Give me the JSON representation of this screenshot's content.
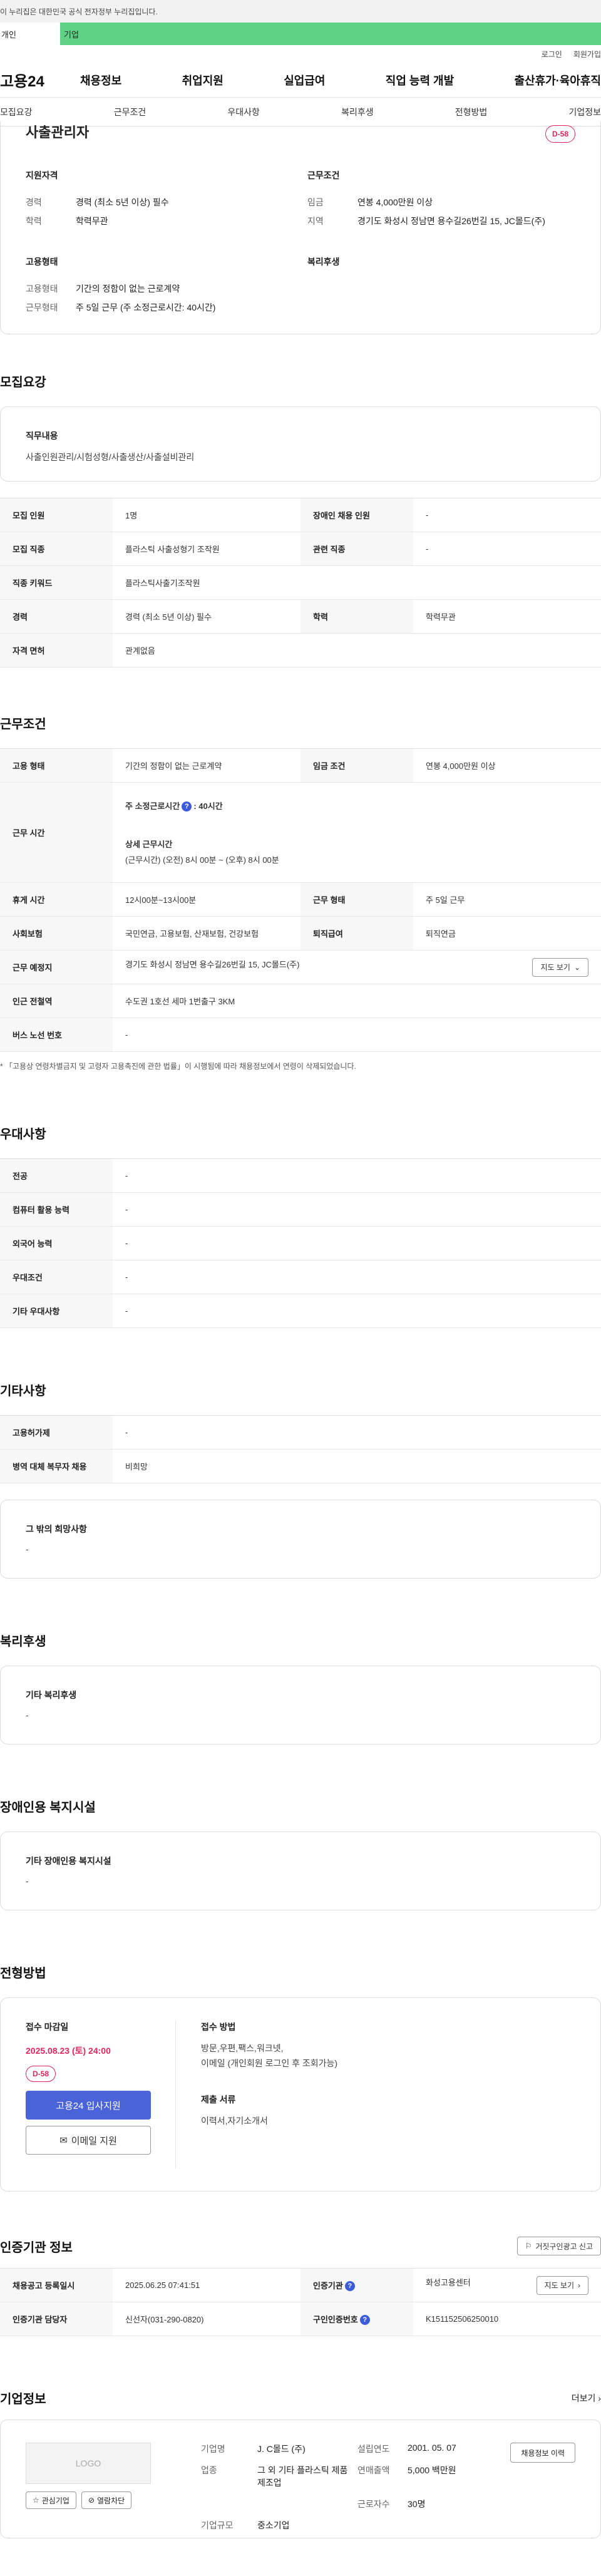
{
  "banner": "이 누리집은 대한민국 공식 전자정부 누리집입니다.",
  "user_tabs": [
    "개인",
    "기업"
  ],
  "util": [
    "로그인",
    "회원가입"
  ],
  "gnb": {
    "logo": "고용24",
    "menu": [
      "채용정보",
      "취업지원",
      "실업급여",
      "직업 능력 개발",
      "출산휴가·육아휴직"
    ]
  },
  "subnav": [
    "모집요강",
    "근무조건",
    "우대사항",
    "복리후생",
    "전형방법",
    "기업정보"
  ],
  "summary": {
    "title": "사출관리자",
    "dday": "D-58",
    "qual_head": "지원자격",
    "qual": [
      {
        "k": "경력",
        "v": "경력 (최소 5년 이상) 필수"
      },
      {
        "k": "학력",
        "v": "학력무관"
      }
    ],
    "cond_head": "근무조건",
    "cond": [
      {
        "k": "임금",
        "v": "연봉 4,000만원 이상"
      },
      {
        "k": "지역",
        "v": "경기도 화성시 정남면 용수길26번길 15, JC몰드(주)"
      }
    ],
    "emp_head": "고용형태",
    "emp": [
      {
        "k": "고용형태",
        "v": "기간의 정함이 없는 근로계약"
      },
      {
        "k": "근무형태",
        "v": "주 5일 근무 (주 소정근로시간: 40시간)"
      }
    ],
    "welfare_head": "복리후생"
  },
  "recruit": {
    "title": "모집요강",
    "duty_head": "직무내용",
    "duty": "사출인원관리/시험성형/사출생산/사출설비관리",
    "rows": [
      [
        {
          "th": "모집 인원"
        },
        {
          "v": "1명"
        },
        {
          "th": "장애인 채용 인원"
        },
        {
          "v": "-"
        }
      ],
      [
        {
          "th": "모집 직종"
        },
        {
          "v": "플라스틱 사출성형기 조작원"
        },
        {
          "th": "관련 직종"
        },
        {
          "v": "-"
        }
      ],
      [
        {
          "th": "직종 키워드"
        },
        {
          "v": "플라스틱사출기조작원"
        }
      ],
      [
        {
          "th": "경력"
        },
        {
          "v": "경력 (최소 5년 이상) 필수"
        },
        {
          "th": "학력"
        },
        {
          "v": "학력무관"
        }
      ],
      [
        {
          "th": "자격 면허"
        },
        {
          "v": "관계없음"
        }
      ]
    ]
  },
  "work": {
    "title": "근무조건",
    "emp_type_th": "고용 형태",
    "emp_type": "기간의 정함이 없는 근로계약",
    "wage_th": "임금 조건",
    "wage": "연봉 4,000만원 이상",
    "hours_th": "근무 시간",
    "hours_main": "주 소정근로시간",
    "hours_main_val": ": 40시간",
    "hours_detail_head": "상세 근무시간",
    "hours_detail": "(근무시간) (오전) 8시 00분 ~ (오후) 8시 00분",
    "break_th": "휴게 시간",
    "break": "12시00분~13시00분",
    "form_th": "근무 형태",
    "form": "주 5일 근무",
    "insure_th": "사회보험",
    "insure": "국민연금, 고용보험, 산재보험, 건강보험",
    "retire_th": "퇴직급여",
    "retire": "퇴직연금",
    "place_th": "근무 예정지",
    "place": "경기도 화성시 정남면 용수길26번길 15, JC몰드(주)",
    "map_btn": "지도 보기",
    "subway_th": "인근 전철역",
    "subway": "수도권 1호선 세마 1번출구 3KM",
    "bus_th": "버스 노선 번호",
    "bus": "-",
    "note": "* 「고용상 연령차별금지 및 고령자 고용촉진에 관한 법률」이 시행됨에 따라 채용정보에서 연령이 삭제되었습니다."
  },
  "prefer": {
    "title": "우대사항",
    "rows": [
      {
        "th": "전공",
        "v": "-"
      },
      {
        "th": "컴퓨터 활용 능력",
        "v": "-"
      },
      {
        "th": "외국어 능력",
        "v": "-"
      },
      {
        "th": "우대조건",
        "v": "-"
      },
      {
        "th": "기타 우대사항",
        "v": "-"
      }
    ]
  },
  "etc": {
    "title": "기타사항",
    "rows": [
      {
        "th": "고용허가제",
        "v": "-"
      },
      {
        "th": "병역 대체 복무자 채용",
        "v": "비희망"
      }
    ],
    "box_head": "그 밖의 희망사항",
    "box_val": "-"
  },
  "welfare": {
    "title": "복리후생",
    "box_head": "기타 복리후생",
    "box_val": "-"
  },
  "disabled": {
    "title": "장애인용 복지시설",
    "box_head": "기타 장애인용 복지시설",
    "box_val": "-"
  },
  "selection": {
    "title": "전형방법",
    "deadline_label": "접수 마감일",
    "deadline": "2025.08.23 (토) 24:00",
    "dday": "D-58",
    "apply_btn": "고용24 입사지원",
    "email_btn": "이메일 지원",
    "method_head": "접수 방법",
    "method": "방문,우편,팩스,워크넷,",
    "method2": "이메일 (개인회원 로그인 후 조회가능)",
    "docs_head": "제출 서류",
    "docs": "이력서,자기소개서"
  },
  "cert": {
    "title": "인증기관 정보",
    "report_btn": "거짓구인광고 신고",
    "reg_th": "채용공고 등록일시",
    "reg": "2025.06.25 07:41:51",
    "org_th": "인증기관",
    "org": "화성고용센터",
    "map_btn": "지도 보기",
    "mgr_th": "인증기관 담당자",
    "mgr": "신선자(031-290-0820)",
    "no_th": "구인인증번호",
    "no": "K151152506250010"
  },
  "company": {
    "title": "기업정보",
    "more": "더보기",
    "logo": "LOGO",
    "fav_btn": "관심기업",
    "block_btn": "열람차단",
    "name_k": "기업명",
    "name": "J. C몰드 (주)",
    "found_k": "설립연도",
    "found": "2001. 05. 07",
    "industry_k": "업종",
    "industry": "그 외 기타 플라스틱 제품 제조업",
    "sales_k": "연매출액",
    "sales": "5,000 백만원",
    "staff_k": "근로자수",
    "staff": "30명",
    "size_k": "기업규모",
    "size": "중소기업",
    "jobs_btn": "채용정보 이력"
  }
}
